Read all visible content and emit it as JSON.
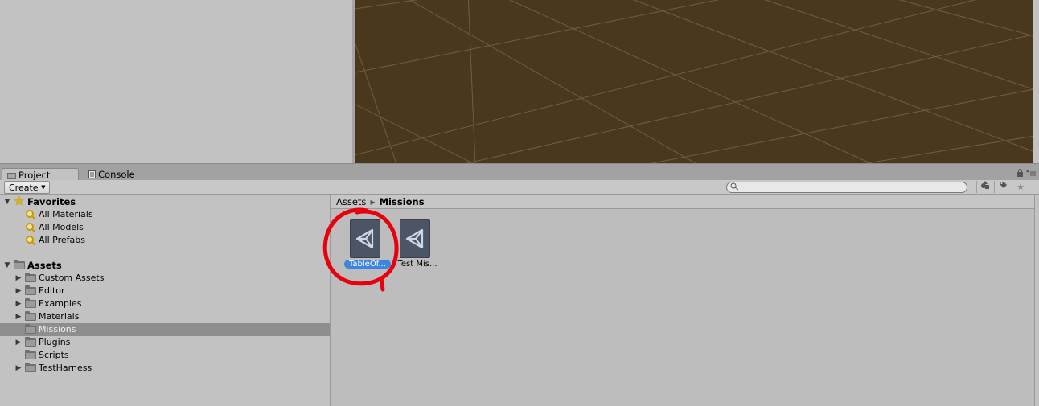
{
  "tabs": {
    "project_label": "Project",
    "console_label": "Console"
  },
  "toolbar": {
    "create_label": "Create",
    "search_placeholder": ""
  },
  "tree": {
    "favorites": {
      "label": "Favorites",
      "items": [
        "All Materials",
        "All Models",
        "All Prefabs"
      ]
    },
    "assets": {
      "label": "Assets",
      "items": [
        {
          "label": "Custom Assets",
          "expandable": true,
          "selected": false
        },
        {
          "label": "Editor",
          "expandable": true,
          "selected": false
        },
        {
          "label": "Examples",
          "expandable": true,
          "selected": false
        },
        {
          "label": "Materials",
          "expandable": true,
          "selected": false
        },
        {
          "label": "Missions",
          "expandable": false,
          "selected": true
        },
        {
          "label": "Plugins",
          "expandable": true,
          "selected": false
        },
        {
          "label": "Scripts",
          "expandable": false,
          "selected": false
        },
        {
          "label": "TestHarness",
          "expandable": true,
          "selected": false
        }
      ]
    }
  },
  "breadcrumb": {
    "root": "Assets",
    "current": "Missions"
  },
  "assets_grid": [
    {
      "name": "TableOf...",
      "selected": true,
      "icon": "unity-logo-icon"
    },
    {
      "name": "Test Mis...",
      "selected": false,
      "icon": "unity-logo-icon"
    }
  ],
  "colors": {
    "scene_background": "#4a381e",
    "selection_blue": "#3d86e0",
    "annotation_red": "#e8000c"
  }
}
